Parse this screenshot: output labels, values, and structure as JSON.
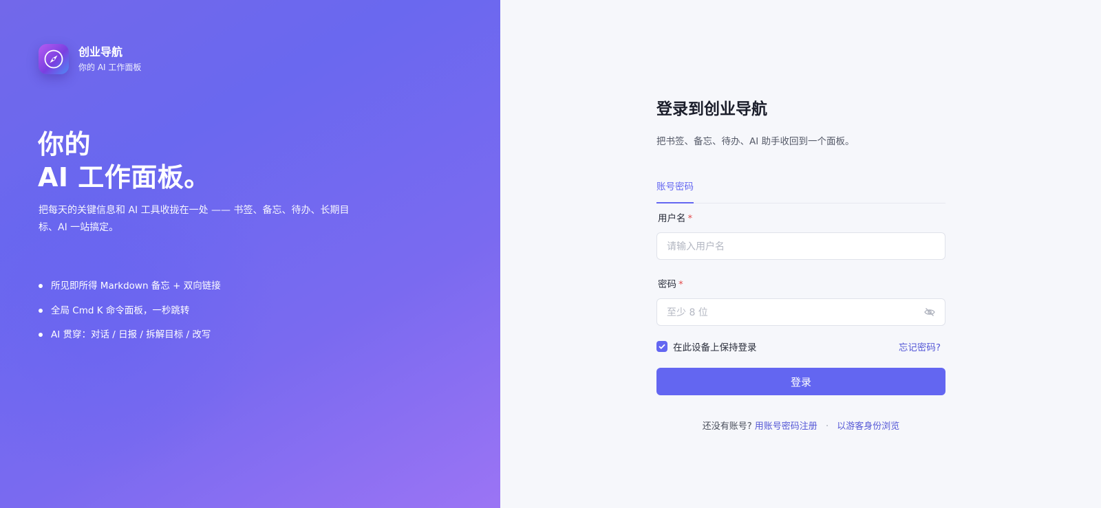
{
  "brand": {
    "name": "创业导航",
    "tagline": "你的 AI 工作面板"
  },
  "hero": {
    "headline_line1": "你的",
    "headline_line2": "AI 工作面板。",
    "intro": "把每天的关键信息和 AI 工具收拢在一处 —— 书签、备忘、待办、长期目标、AI 一站搞定。",
    "features": [
      "所见即所得 Markdown 备忘 + 双向链接",
      "全局 Cmd K 命令面板，一秒跳转",
      "AI 贯穿：对话 / 日报 / 拆解目标 / 改写"
    ]
  },
  "form": {
    "title": "登录到创业导航",
    "subtitle": "把书签、备忘、待办、AI 助手收回到一个面板。",
    "tab_label": "账号密码",
    "username_label": "用户名",
    "username_placeholder": "请输入用户名",
    "password_label": "密码",
    "password_placeholder": "至少 8 位",
    "required_mark": "*",
    "remember_label": "在此设备上保持登录",
    "remember_checked": true,
    "forgot_label": "忘记密码?",
    "submit_label": "登录",
    "no_account_text": "还没有账号?",
    "register_link": "用账号密码注册",
    "separator": "·",
    "guest_link": "以游客身份浏览"
  },
  "colors": {
    "accent": "#6366f1",
    "link": "#5457d6",
    "required": "#e34d4d",
    "panel_bg": "#f6f7fb"
  },
  "icons": {
    "logo": "compass-icon",
    "password_toggle": "eye-off-icon",
    "checkbox": "check-icon"
  }
}
